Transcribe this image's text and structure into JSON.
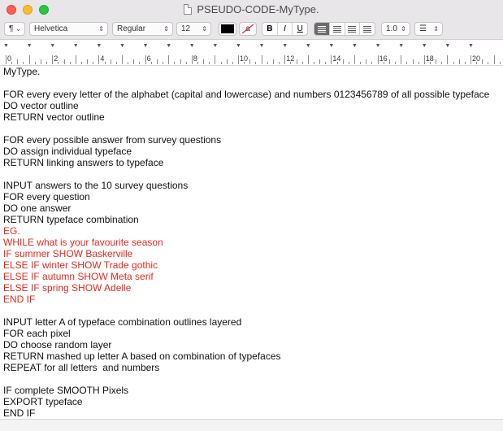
{
  "window": {
    "title": "PSEUDO-CODE-MyType."
  },
  "toolbar": {
    "paragraph_style": "¶",
    "font_family": "Helvetica",
    "typeface": "Regular",
    "font_size": "12",
    "bold": "B",
    "italic": "I",
    "underline": "U",
    "line_spacing": "1.0",
    "text_color": "#000000",
    "highlight_glyph": "a"
  },
  "ruler": {
    "labels": [
      "0",
      "2",
      "4",
      "6",
      "8",
      "10",
      "12",
      "14",
      "16",
      "18",
      "20"
    ]
  },
  "document": {
    "lines": [
      {
        "text": "MyType.",
        "red": false
      },
      {
        "text": "",
        "red": false
      },
      {
        "text": "FOR every every letter of the alphabet (capital and lowercase) and numbers 0123456789 of all possible typeface",
        "red": false
      },
      {
        "text": "DO vector outline",
        "red": false
      },
      {
        "text": "RETURN vector outline",
        "red": false
      },
      {
        "text": "",
        "red": false
      },
      {
        "text": "FOR every possible answer from survey questions",
        "red": false
      },
      {
        "text": "DO assign individual typeface",
        "red": false
      },
      {
        "text": "RETURN linking answers to typeface",
        "red": false
      },
      {
        "text": "",
        "red": false
      },
      {
        "text": "INPUT answers to the 10 survey questions",
        "red": false
      },
      {
        "text": "FOR every question",
        "red": false
      },
      {
        "text": "DO one answer",
        "red": false
      },
      {
        "text": "RETURN typeface combination",
        "red": false
      },
      {
        "text": "EG.",
        "red": true
      },
      {
        "text": "WHILE what is your favourite season",
        "red": true
      },
      {
        "text": "IF summer SHOW Baskerville",
        "red": true
      },
      {
        "text": "ELSE IF winter SHOW Trade gothic",
        "red": true
      },
      {
        "text": "ELSE IF autumn SHOW Meta serif",
        "red": true
      },
      {
        "text": "ELSE IF spring SHOW Adelle",
        "red": true
      },
      {
        "text": "END IF",
        "red": true
      },
      {
        "text": "",
        "red": false
      },
      {
        "text": "INPUT letter A of typeface combination outlines layered",
        "red": false
      },
      {
        "text": "FOR each pixel",
        "red": false
      },
      {
        "text": "DO choose random layer",
        "red": false
      },
      {
        "text": "RETURN mashed up letter A based on combination of typefaces",
        "red": false
      },
      {
        "text": "REPEAT for all letters  and numbers",
        "red": false
      },
      {
        "text": "",
        "red": false
      },
      {
        "text": "IF complete SMOOTH Pixels",
        "red": false
      },
      {
        "text": "EXPORT typeface",
        "red": false
      },
      {
        "text": "END IF",
        "red": false
      }
    ]
  }
}
